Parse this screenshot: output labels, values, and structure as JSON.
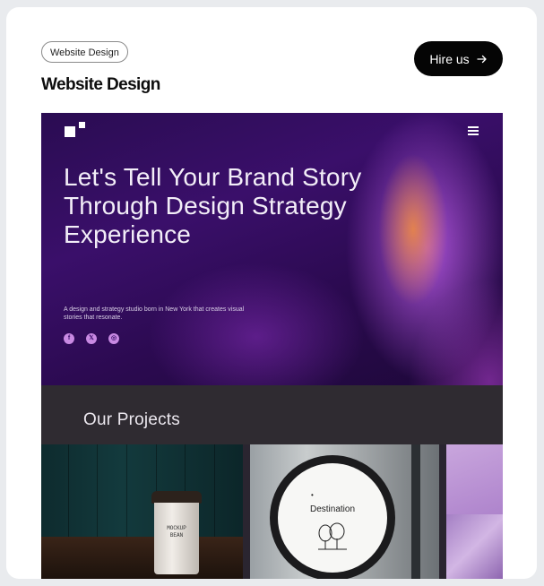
{
  "card": {
    "tag": "Website Design",
    "title": "Website Design",
    "hire_button": "Hire us"
  },
  "preview": {
    "headline": "Let's Tell Your Brand Story Through Design Strategy Experience",
    "subtext": "A design and strategy studio born in New York that creates visual stories that resonate.",
    "socials": [
      "f",
      "𝕏",
      "◎"
    ],
    "projects_title": "Our Projects",
    "cup_text": "MOCKUP\nBEAN",
    "sign_text": "Destination",
    "sign_dot": "•"
  },
  "colors": {
    "hero_purple": "#3a0f6a",
    "accent_orange": "#f08c3c",
    "button_black": "#050505"
  },
  "icons": [
    "arrow-right-icon",
    "hamburger-menu-icon",
    "facebook-icon",
    "x-icon",
    "instagram-icon"
  ]
}
